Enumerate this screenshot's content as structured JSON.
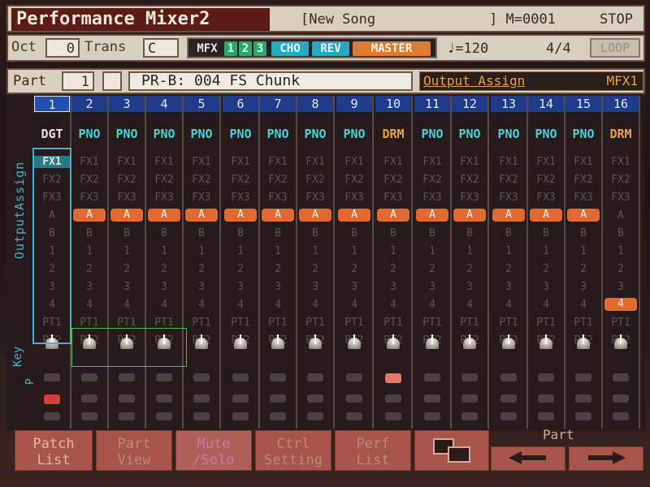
{
  "header": {
    "title": "Performance Mixer2",
    "song_name": "[New Song",
    "song_end": "]",
    "measure": "M=0001",
    "status": "STOP"
  },
  "controls": {
    "oct_label": "Oct",
    "oct_value": "0",
    "trans_label": "Trans",
    "trans_value": "C",
    "fx_buttons": [
      "MFX",
      "1",
      "2",
      "3",
      "CHO",
      "REV",
      "MASTER"
    ],
    "tempo": "♩=120",
    "meter": "4/4",
    "loop_label": "LOOP"
  },
  "part_row": {
    "part_label": "Part",
    "part_value": "1",
    "patch_name": "PR-B: 004 FS Chunk",
    "output_assign_label": "Output Assign",
    "output_assign_value": "MFX1"
  },
  "side_labels": {
    "output_assign": "OutputAssign",
    "key": "Key",
    "p": "P"
  },
  "channels": [
    {
      "num": "1",
      "cat": "DGT",
      "out": "FX1"
    },
    {
      "num": "2",
      "cat": "PNO",
      "out": "A"
    },
    {
      "num": "3",
      "cat": "PNO",
      "out": "A"
    },
    {
      "num": "4",
      "cat": "PNO",
      "out": "A"
    },
    {
      "num": "5",
      "cat": "PNO",
      "out": "A"
    },
    {
      "num": "6",
      "cat": "PNO",
      "out": "A"
    },
    {
      "num": "7",
      "cat": "PNO",
      "out": "A"
    },
    {
      "num": "8",
      "cat": "PNO",
      "out": "A"
    },
    {
      "num": "9",
      "cat": "PNO",
      "out": "A"
    },
    {
      "num": "10",
      "cat": "DRM",
      "out": "A"
    },
    {
      "num": "11",
      "cat": "PNO",
      "out": "A"
    },
    {
      "num": "12",
      "cat": "PNO",
      "out": "A"
    },
    {
      "num": "13",
      "cat": "PNO",
      "out": "A"
    },
    {
      "num": "14",
      "cat": "PNO",
      "out": "A"
    },
    {
      "num": "15",
      "cat": "PNO",
      "out": "A"
    },
    {
      "num": "16",
      "cat": "DRM",
      "out": "4"
    }
  ],
  "out_rows": [
    "FX1",
    "FX2",
    "FX3",
    "A",
    "B",
    "1",
    "2",
    "3",
    "4",
    "PT1",
    "PT2"
  ],
  "colors": {
    "accent_cyan": "#4ab0c8",
    "cat_pno": "#4ad0d8",
    "cat_drm": "#e8a24a",
    "assign_orange": "#e06a30",
    "channel_blue": "#1e3c8a"
  },
  "bottom_buttons": [
    {
      "line1": "Patch",
      "line2": "List"
    },
    {
      "line1": "Part",
      "line2": "View"
    },
    {
      "line1": "Mute",
      "line2": "/Solo"
    },
    {
      "line1": "Ctrl",
      "line2": "Setting"
    },
    {
      "line1": "Perf",
      "line2": "List"
    }
  ],
  "part_nav_label": "Part"
}
